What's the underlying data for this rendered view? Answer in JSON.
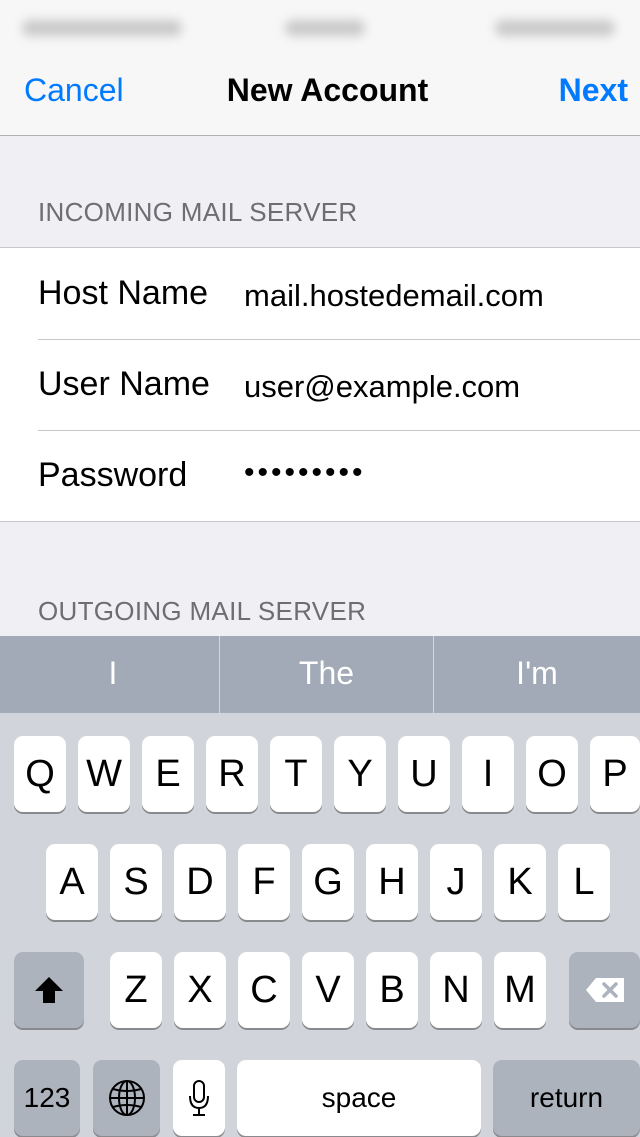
{
  "nav": {
    "cancel": "Cancel",
    "title": "New Account",
    "next": "Next"
  },
  "incoming": {
    "header": "INCOMING MAIL SERVER",
    "rows": [
      {
        "label": "Host Name",
        "value": "mail.hostedemail.com"
      },
      {
        "label": "User Name",
        "value": "user@example.com"
      },
      {
        "label": "Password",
        "value": "•••••••••"
      }
    ]
  },
  "outgoing": {
    "header": "OUTGOING MAIL SERVER"
  },
  "keyboard": {
    "suggestions": [
      "I",
      "The",
      "I'm"
    ],
    "row1": [
      "Q",
      "W",
      "E",
      "R",
      "T",
      "Y",
      "U",
      "I",
      "O",
      "P"
    ],
    "row2": [
      "A",
      "S",
      "D",
      "F",
      "G",
      "H",
      "J",
      "K",
      "L"
    ],
    "row3": [
      "Z",
      "X",
      "C",
      "V",
      "B",
      "N",
      "M"
    ],
    "numbers_label": "123",
    "space_label": "space",
    "return_label": "return",
    "icons": {
      "shift": "shift-icon",
      "delete": "delete-icon",
      "globe": "globe-icon",
      "mic": "microphone-icon"
    }
  }
}
